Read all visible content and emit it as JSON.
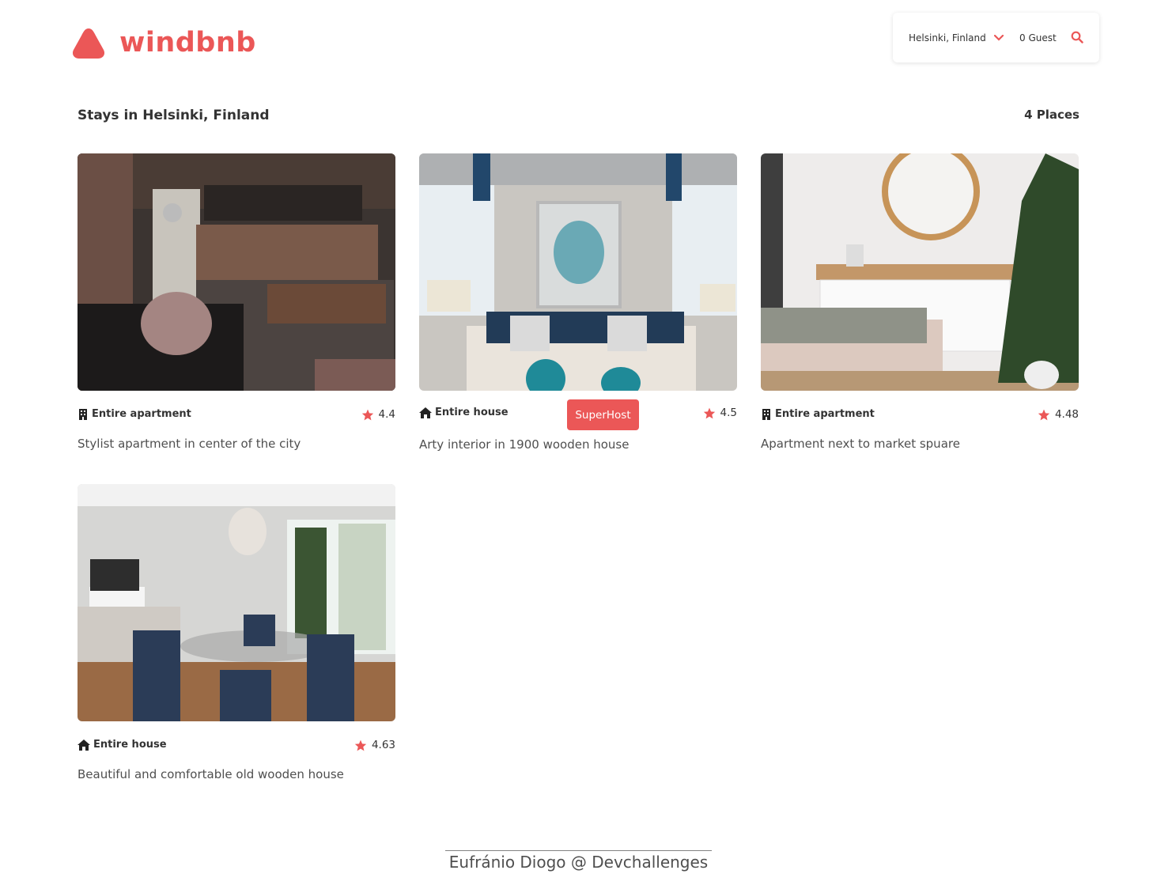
{
  "header": {
    "logo_text": "windbnb",
    "search": {
      "location": "Helsinki, Finland",
      "guests": "0 Guest"
    }
  },
  "stays": {
    "title": "Stays in Helsinki, Finland",
    "count": "4 Places",
    "items": [
      {
        "type": "Entire apartment",
        "type_icon": "building-icon",
        "rating": "4.4",
        "title": "Stylist apartment in center of the city",
        "superhost": ""
      },
      {
        "type": "Entire house",
        "type_icon": "house-icon",
        "rating": "4.5",
        "title": "Arty interior in 1900 wooden house",
        "superhost": "SuperHost"
      },
      {
        "type": "Entire apartment",
        "type_icon": "building-icon",
        "rating": "4.48",
        "title": "Apartment next to market spuare",
        "superhost": ""
      },
      {
        "type": "Entire house",
        "type_icon": "house-icon",
        "rating": "4.63",
        "title": "Beautiful and comfortable old wooden house",
        "superhost": ""
      }
    ]
  },
  "footer": {
    "credit": "Eufránio Diogo @ Devchallenges"
  },
  "colors": {
    "brand": "#eb5757",
    "text": "#333333",
    "muted": "#4f4f4f"
  }
}
